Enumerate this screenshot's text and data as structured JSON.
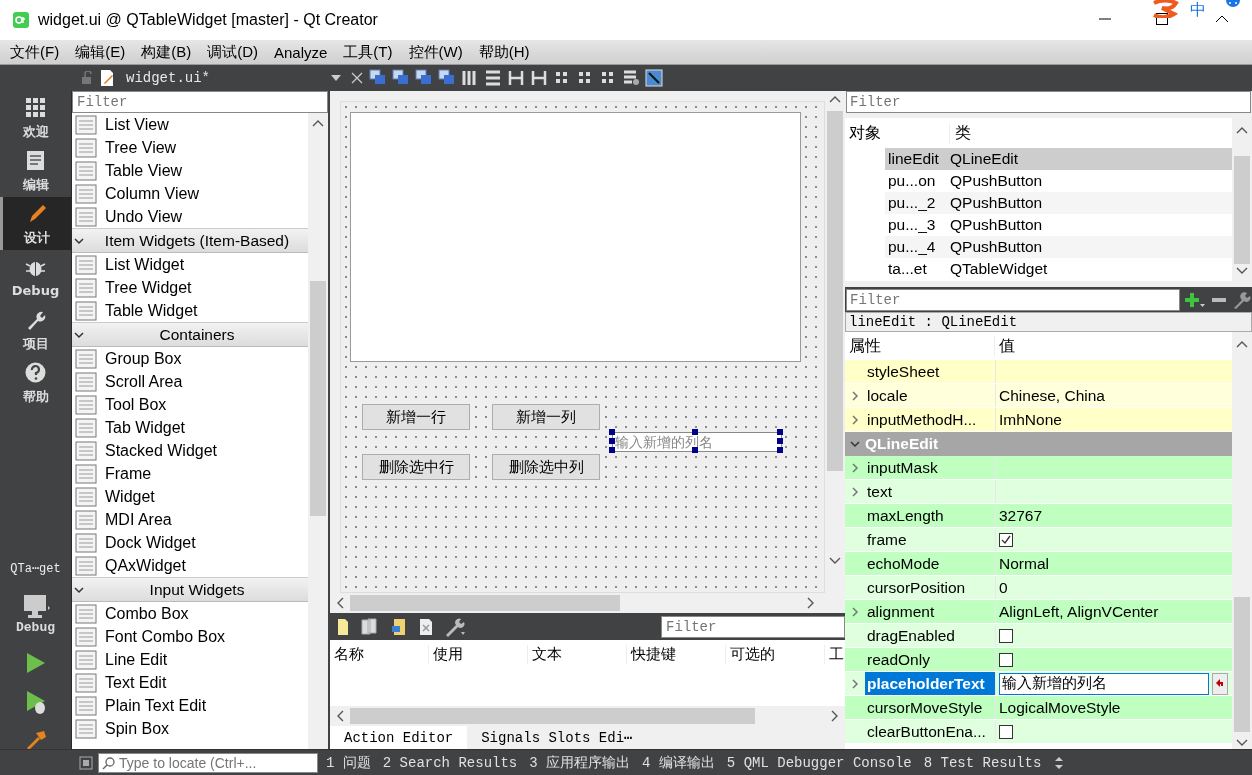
{
  "window": {
    "title": "widget.ui @ QTableWidget [master] - Qt Creator",
    "ime": "中"
  },
  "menu": [
    "文件(F)",
    "编辑(E)",
    "构建(B)",
    "调试(D)",
    "Analyze",
    "工具(T)",
    "控件(W)",
    "帮助(H)"
  ],
  "editor_tab": {
    "file": "widget.ui*"
  },
  "mode_bar": [
    {
      "kind": "welcome",
      "label": "欢迎",
      "selected": false
    },
    {
      "kind": "edit",
      "label": "编辑",
      "selected": false
    },
    {
      "kind": "design",
      "label": "设计",
      "selected": true
    },
    {
      "kind": "debug",
      "label": "Debug",
      "selected": false
    },
    {
      "kind": "projects",
      "label": "项目",
      "selected": false
    },
    {
      "kind": "help",
      "label": "帮助",
      "selected": false
    }
  ],
  "kit": {
    "project": "QTa⋯get",
    "config": "Debug"
  },
  "widget_box": {
    "filter_placeholder": "Filter",
    "items": [
      {
        "kind": "item",
        "label": "List View"
      },
      {
        "kind": "item",
        "label": "Tree View"
      },
      {
        "kind": "item",
        "label": "Table View"
      },
      {
        "kind": "item",
        "label": "Column View"
      },
      {
        "kind": "item",
        "label": "Undo View"
      },
      {
        "kind": "section",
        "label": "Item Widgets (Item-Based)",
        "expanded": true
      },
      {
        "kind": "item",
        "label": "List Widget"
      },
      {
        "kind": "item",
        "label": "Tree Widget"
      },
      {
        "kind": "item",
        "label": "Table Widget"
      },
      {
        "kind": "section",
        "label": "Containers",
        "expanded": true
      },
      {
        "kind": "item",
        "label": "Group Box"
      },
      {
        "kind": "item",
        "label": "Scroll Area"
      },
      {
        "kind": "item",
        "label": "Tool Box"
      },
      {
        "kind": "item",
        "label": "Tab Widget"
      },
      {
        "kind": "item",
        "label": "Stacked Widget"
      },
      {
        "kind": "item",
        "label": "Frame"
      },
      {
        "kind": "item",
        "label": "Widget"
      },
      {
        "kind": "item",
        "label": "MDI Area"
      },
      {
        "kind": "item",
        "label": "Dock Widget"
      },
      {
        "kind": "item",
        "label": "QAxWidget"
      },
      {
        "kind": "section",
        "label": "Input Widgets",
        "expanded": true
      },
      {
        "kind": "item",
        "label": "Combo Box"
      },
      {
        "kind": "item",
        "label": "Font Combo Box"
      },
      {
        "kind": "item",
        "label": "Line Edit"
      },
      {
        "kind": "item",
        "label": "Text Edit"
      },
      {
        "kind": "item",
        "label": "Plain Text Edit"
      },
      {
        "kind": "item",
        "label": "Spin Box"
      }
    ]
  },
  "form": {
    "buttons": [
      "新增一行",
      "新增一列",
      "删除选中行",
      "删除选中列"
    ],
    "line_edit": {
      "placeholder": "输入新增的列名",
      "selected": true
    }
  },
  "action_editor": {
    "filter_placeholder": "Filter",
    "columns": [
      "名称",
      "使用",
      "文本",
      "快捷键",
      "可选的",
      "工"
    ],
    "tabs": [
      {
        "label": "Action Editor",
        "selected": true
      },
      {
        "label": "Signals  Slots Edi⋯",
        "selected": false
      }
    ]
  },
  "object_inspector": {
    "filter_placeholder": "Filter",
    "columns": [
      "对象",
      "类"
    ],
    "rows": [
      {
        "object": "lineEdit",
        "class": "QLineEdit",
        "selected": true
      },
      {
        "object": "pu...on",
        "class": "QPushButton",
        "selected": false
      },
      {
        "object": "pu..._2",
        "class": "QPushButton",
        "selected": false
      },
      {
        "object": "pu..._3",
        "class": "QPushButton",
        "selected": false
      },
      {
        "object": "pu..._4",
        "class": "QPushButton",
        "selected": false
      },
      {
        "object": "ta...et",
        "class": "QTableWidget",
        "selected": false
      }
    ]
  },
  "property_editor": {
    "filter_placeholder": "Filter",
    "object": "lineEdit : QLineEdit",
    "columns": [
      "属性",
      "值"
    ],
    "rows": [
      {
        "kind": "text",
        "name": "styleSheet",
        "expandable": false,
        "color": "#ffffc8",
        "selected": false
      },
      {
        "kind": "text",
        "name": "locale",
        "value": "Chinese, China",
        "expandable": true,
        "color": "#ffffdc",
        "selected": false
      },
      {
        "kind": "text",
        "name": "inputMethodH...",
        "value": "ImhNone",
        "expandable": true,
        "color": "#ffffc8",
        "selected": false
      },
      {
        "kind": "group",
        "name": "QLineEdit",
        "expanded": true,
        "color": "#a6a6a6"
      },
      {
        "kind": "text",
        "name": "inputMask",
        "expandable": true,
        "color": "#bfffbf",
        "selected": false
      },
      {
        "kind": "text",
        "name": "text",
        "expandable": true,
        "color": "#dfffdf",
        "selected": false
      },
      {
        "kind": "text",
        "name": "maxLength",
        "value": "32767",
        "expandable": false,
        "color": "#bfffbf",
        "selected": false
      },
      {
        "kind": "check",
        "name": "frame",
        "checked": true,
        "expandable": false,
        "color": "#dfffdf",
        "selected": false
      },
      {
        "kind": "text",
        "name": "echoMode",
        "value": "Normal",
        "expandable": false,
        "color": "#bfffbf",
        "selected": false
      },
      {
        "kind": "text",
        "name": "cursorPosition",
        "value": "0",
        "expandable": false,
        "color": "#dfffdf",
        "selected": false
      },
      {
        "kind": "text",
        "name": "alignment",
        "value": "AlignLeft, AlignVCenter",
        "expandable": true,
        "color": "#bfffbf",
        "selected": false
      },
      {
        "kind": "check",
        "name": "dragEnabled",
        "checked": false,
        "expandable": false,
        "color": "#dfffdf",
        "selected": false
      },
      {
        "kind": "check",
        "name": "readOnly",
        "checked": false,
        "expandable": false,
        "color": "#bfffbf",
        "selected": false
      },
      {
        "kind": "edit",
        "name": "placeholderText",
        "value": "输入新增的列名",
        "expandable": true,
        "color": "#dfffdf",
        "selected": true
      },
      {
        "kind": "text",
        "name": "cursorMoveStyle",
        "value": "LogicalMoveStyle",
        "expandable": false,
        "color": "#bfffbf",
        "selected": false
      },
      {
        "kind": "check",
        "name": "clearButtonEna...",
        "checked": false,
        "expandable": false,
        "color": "#dfffdf",
        "selected": false
      }
    ]
  },
  "status_bar": {
    "locate_placeholder": "Type to locate (Ctrl+...",
    "outputs": [
      "1 问题",
      "2 Search Results",
      "3 应用程序输出",
      "4 编译输出",
      "5 QML Debugger Console",
      "8 Test Results"
    ]
  }
}
